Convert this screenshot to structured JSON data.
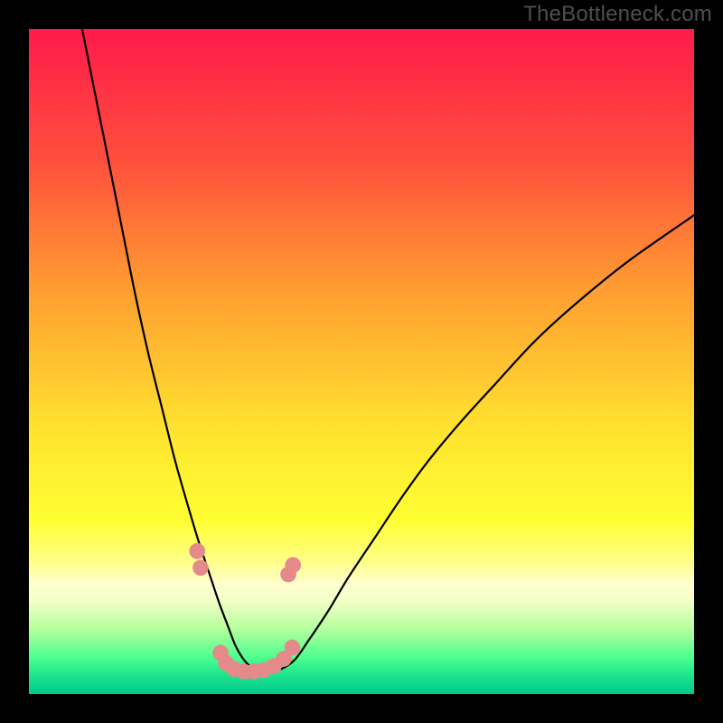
{
  "watermark": "TheBottleneck.com",
  "chart_data": {
    "type": "line",
    "title": "",
    "xlabel": "",
    "ylabel": "",
    "xlim": [
      0,
      100
    ],
    "ylim": [
      0,
      100
    ],
    "background_gradient": {
      "stops": [
        {
          "offset": 0.0,
          "color": "#ff1a4b"
        },
        {
          "offset": 0.2,
          "color": "#ff503c"
        },
        {
          "offset": 0.4,
          "color": "#ffa031"
        },
        {
          "offset": 0.6,
          "color": "#ffe22f"
        },
        {
          "offset": 0.74,
          "color": "#ffff33"
        },
        {
          "offset": 0.8,
          "color": "#ffff88"
        },
        {
          "offset": 0.835,
          "color": "#ffffd0"
        },
        {
          "offset": 0.86,
          "color": "#f4ffc8"
        },
        {
          "offset": 0.9,
          "color": "#b8ff9e"
        },
        {
          "offset": 0.945,
          "color": "#4dff8e"
        },
        {
          "offset": 0.97,
          "color": "#20e58e"
        },
        {
          "offset": 1.0,
          "color": "#00c98a"
        }
      ]
    },
    "series": [
      {
        "name": "bottleneck-curve",
        "color": "#000000",
        "x": [
          8,
          10,
          12,
          14,
          16,
          18,
          20,
          22,
          24,
          25.5,
          27,
          28.5,
          30,
          31,
          32,
          33,
          34,
          36,
          38,
          40,
          42,
          45,
          48,
          52,
          56,
          60,
          65,
          70,
          76,
          82,
          90,
          100
        ],
        "y": [
          100,
          90,
          80,
          70,
          60,
          51,
          43,
          35,
          28,
          23,
          18.5,
          14,
          10,
          7.4,
          5.6,
          4.4,
          3.8,
          3.4,
          3.8,
          5.2,
          8,
          12.5,
          17.5,
          23.5,
          29.5,
          35,
          41,
          46.5,
          53,
          58.5,
          65,
          72
        ]
      }
    ],
    "markers": [
      {
        "name": "dotted-bottom-markers",
        "color": "#e58a8a",
        "radius_pct": 1.2,
        "points": [
          {
            "x": 25.3,
            "y": 21.5
          },
          {
            "x": 25.8,
            "y": 19.0
          },
          {
            "x": 28.8,
            "y": 6.2
          },
          {
            "x": 29.6,
            "y": 4.7
          },
          {
            "x": 30.8,
            "y": 3.8
          },
          {
            "x": 32.3,
            "y": 3.4
          },
          {
            "x": 33.8,
            "y": 3.4
          },
          {
            "x": 35.3,
            "y": 3.6
          },
          {
            "x": 36.8,
            "y": 4.2
          },
          {
            "x": 38.3,
            "y": 5.3
          },
          {
            "x": 39.6,
            "y": 7.0
          },
          {
            "x": 39.0,
            "y": 18.0
          },
          {
            "x": 39.7,
            "y": 19.4
          }
        ]
      }
    ]
  }
}
